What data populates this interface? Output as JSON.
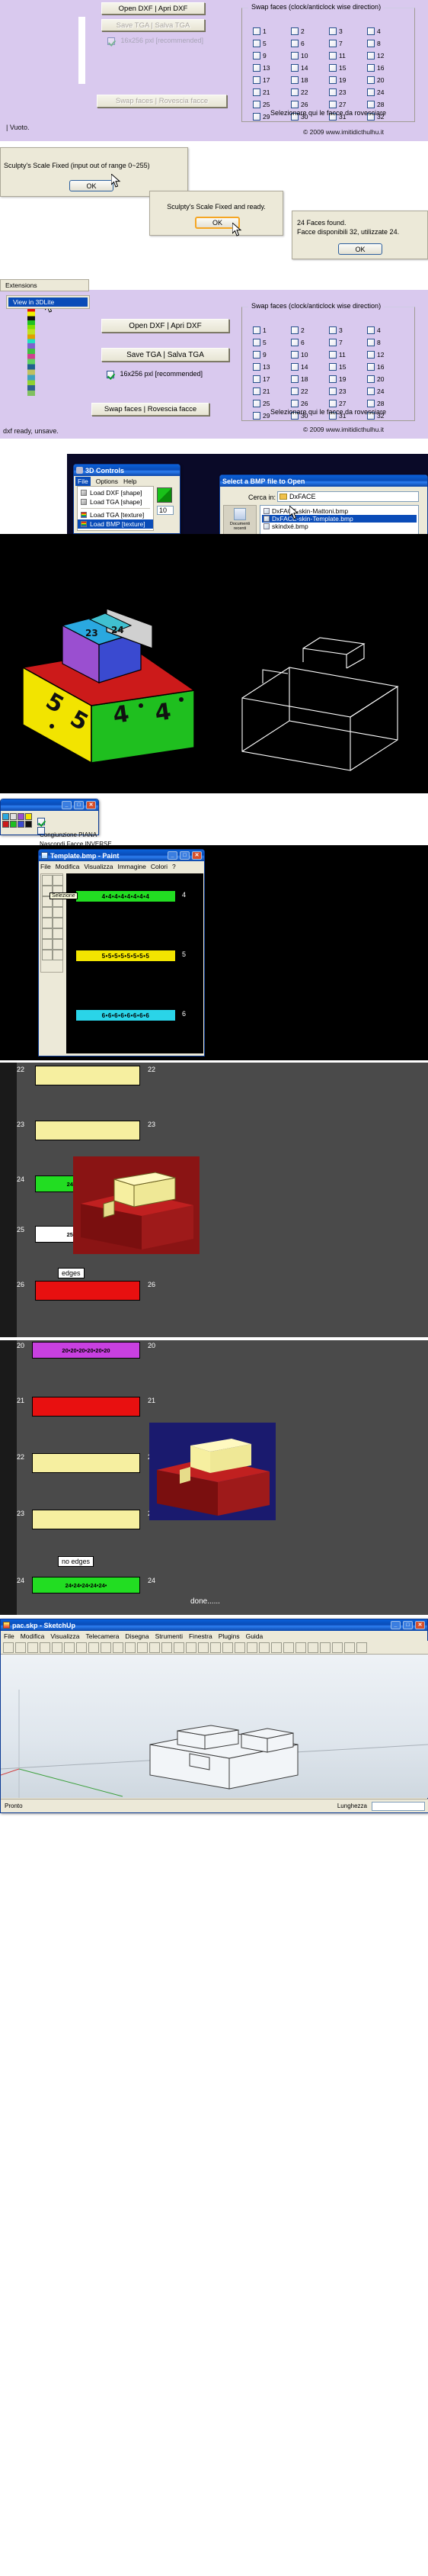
{
  "dxface_panel": {
    "buttons": {
      "open_dxf": "Open DXF  |  Apri DXF",
      "save_tga": "Save TGA  |  Salva TGA",
      "swap_faces": "Swap faces  |  Rovescia facce"
    },
    "checkbox_16x256": "16x256 pxl [recommended]",
    "swap_group_title": "Swap faces (clock/anticlock wise direction)",
    "swap_hint": "Selezionare qui le facce da rovesciare",
    "face_numbers": [
      1,
      2,
      3,
      4,
      5,
      6,
      7,
      8,
      9,
      10,
      11,
      12,
      13,
      14,
      15,
      16,
      17,
      18,
      19,
      20,
      21,
      22,
      23,
      24,
      25,
      26,
      27,
      28,
      29,
      30,
      31,
      32
    ],
    "status_top": "| Vuoto.",
    "status_bottom": "dxf ready, unsave.",
    "copyright": "© 2009 www.imitidicthulhu.it",
    "menu_extensions": "Extensions",
    "menu_view_in_3dlite": "View in 3DLite"
  },
  "dialogs": {
    "scale_fixed_range": {
      "text": "Sculpty's Scale Fixed (input out of range 0~255)",
      "ok": "OK"
    },
    "scale_fixed_ready": {
      "text": "Sculpty's Scale Fixed and ready.",
      "ok": "OK"
    },
    "faces_found": {
      "line1": "24 Faces found.",
      "line2": "Facce disponibili 32, utilizzate 24.",
      "ok": "OK"
    }
  },
  "controls_3d": {
    "title": "3D Controls",
    "menus": [
      "File",
      "Options",
      "Help"
    ],
    "file_menu": [
      {
        "label": "Load DXF  [shape]",
        "icon": "cube-icon",
        "selected": false
      },
      {
        "label": "Load TGA  [shape]",
        "icon": "cube-icon",
        "selected": false
      },
      {
        "label": "Load TGA  [texture]",
        "icon": "rainbow-icon",
        "selected": false
      },
      {
        "label": "Load BMP  [texture]",
        "icon": "rainbow-icon",
        "selected": true
      }
    ],
    "side_value": "10"
  },
  "bmp_dialog": {
    "title": "Select a BMP file to Open",
    "look_in_label": "Cerca in:",
    "look_in_value": "DxFACE",
    "places_label": "Documenti\nrecenti",
    "files": [
      {
        "name": "DxFACE-skin-Mattoni.bmp",
        "selected": false
      },
      {
        "name": "DxFACE-skin-Template.bmp",
        "selected": true
      },
      {
        "name": "skindxé.bmp",
        "selected": false
      }
    ]
  },
  "viewer_3d": {
    "face_labels_top": [
      "23",
      "24"
    ],
    "face_labels_left": [
      "5",
      "5"
    ],
    "face_labels_front": [
      "4",
      "4"
    ],
    "colors": {
      "yellow": "#f2e400",
      "red": "#cc1a1a",
      "green": "#1fbf1f",
      "blue": "#3a4ad0",
      "purple": "#9a4fd0"
    }
  },
  "options_dialog": {
    "checkbox_planar": "Congiunzione PIANA",
    "checkbox_hide_inverse": "Nascondi Facce INVERSE"
  },
  "paint_window": {
    "title": "Template.bmp - Paint",
    "menus": [
      "File",
      "Modifica",
      "Visualizza",
      "Immagine",
      "Colori",
      "?"
    ],
    "tool_label": "Selezione",
    "bands": [
      {
        "text": "4•4•4•4•4•4•4•4",
        "color": "#22dd22",
        "right_label": "4"
      },
      {
        "text": "5•5•5•5•5•5•5•5",
        "color": "#f2e400",
        "right_label": "5"
      },
      {
        "text": "6•6•6•6•6•6•6•6",
        "color": "#2ad4e8",
        "right_label": "6"
      }
    ]
  },
  "tga_editor_top": {
    "rows": [
      {
        "num": "22",
        "color": "#f6efa0",
        "text": ""
      },
      {
        "num": "23",
        "color": "#f6efa0",
        "text": ""
      },
      {
        "num": "24",
        "color": "#22dd22",
        "text": "24•24•24•24•24•"
      },
      {
        "num": "25",
        "color": "#ffffff",
        "text": "25•25•25•25•25•"
      },
      {
        "num": "26",
        "color": "#e81010",
        "text": ""
      }
    ],
    "callout": "edges"
  },
  "tga_editor_bottom": {
    "rows": [
      {
        "num": "20",
        "color": "#c840e0",
        "text": "20•20•20•20•20•20"
      },
      {
        "num": "21",
        "color": "#e81010",
        "text": ""
      },
      {
        "num": "22",
        "color": "#f6efa0",
        "text": ""
      },
      {
        "num": "23",
        "color": "#f6efa0",
        "text": ""
      },
      {
        "num": "24",
        "color": "#22dd22",
        "text": "24•24•24•24•24•"
      }
    ],
    "callout": "no edges",
    "done_label": "done......"
  },
  "sketchup": {
    "title": "pac.skp - SketchUp",
    "menus": [
      "File",
      "Modifica",
      "Visualizza",
      "Telecamera",
      "Disegna",
      "Strumenti",
      "Finestra",
      "Plugins",
      "Guida"
    ],
    "status_left": "Pronto",
    "status_right": "Lunghezza"
  }
}
